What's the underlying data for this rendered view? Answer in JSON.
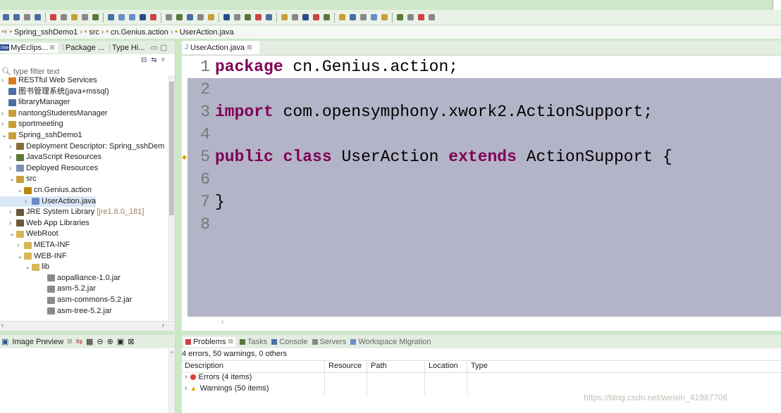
{
  "breadcrumb": [
    "Spring_sshDemo1",
    "src",
    "cn.Genius.action",
    "UserAction.java"
  ],
  "explorer": {
    "tabs": [
      {
        "label": "MyEclips...",
        "close": "⊠"
      },
      {
        "label": "Package ...",
        "close": ""
      },
      {
        "label": "Type Hi...",
        "close": ""
      }
    ],
    "filter_placeholder": "type filter text",
    "items": [
      {
        "label": "RESTful Web Services",
        "indent": 0,
        "twisty": "›",
        "icon": "#d97b1a"
      },
      {
        "label": "图书管理系统(java+mssql)",
        "indent": 0,
        "twisty": "",
        "icon": "#4a6fa5"
      },
      {
        "label": "libraryManager",
        "indent": 0,
        "twisty": "",
        "icon": "#4a6fa5"
      },
      {
        "label": "nantongStudentsManager",
        "indent": 0,
        "twisty": "›",
        "icon": "#c8a038"
      },
      {
        "label": "sportmeeting",
        "indent": 0,
        "twisty": "›",
        "icon": "#c8a038"
      },
      {
        "label": "Spring_sshDemo1",
        "indent": 0,
        "twisty": "⌄",
        "icon": "#c8a038"
      },
      {
        "label": "Deployment Descriptor: Spring_sshDem",
        "indent": 1,
        "twisty": "›",
        "icon": "#8a6d3b"
      },
      {
        "label": "JavaScript Resources",
        "indent": 1,
        "twisty": "›",
        "icon": "#5a7a3a"
      },
      {
        "label": "Deployed Resources",
        "indent": 1,
        "twisty": "›",
        "icon": "#7d8fb3"
      },
      {
        "label": "src",
        "indent": 1,
        "twisty": "⌄",
        "icon": "#c8a038"
      },
      {
        "label": "cn.Genius.action",
        "indent": 2,
        "twisty": "⌄",
        "icon": "#b8860b"
      },
      {
        "label": "UserAction.java",
        "indent": 3,
        "twisty": "›",
        "icon": "#6b8cc7",
        "selected": true
      },
      {
        "label": "JRE System Library",
        "indent": 1,
        "twisty": "›",
        "icon": "#6a5a3a",
        "extra": "[jre1.8.0_181]"
      },
      {
        "label": "Web App Libraries",
        "indent": 1,
        "twisty": "›",
        "icon": "#6a5a3a"
      },
      {
        "label": "WebRoot",
        "indent": 1,
        "twisty": "⌄",
        "icon": "#d6b656"
      },
      {
        "label": "META-INF",
        "indent": 2,
        "twisty": "›",
        "icon": "#d6b656"
      },
      {
        "label": "WEB-INF",
        "indent": 2,
        "twisty": "⌄",
        "icon": "#d6b656"
      },
      {
        "label": "lib",
        "indent": 3,
        "twisty": "⌄",
        "icon": "#d6b656"
      },
      {
        "label": "aopalliance-1.0.jar",
        "indent": 5,
        "twisty": "",
        "icon": "#8a8a8a"
      },
      {
        "label": "asm-5.2.jar",
        "indent": 5,
        "twisty": "",
        "icon": "#8a8a8a"
      },
      {
        "label": "asm-commons-5.2.jar",
        "indent": 5,
        "twisty": "",
        "icon": "#8a8a8a"
      },
      {
        "label": "asm-tree-5.2.jar",
        "indent": 5,
        "twisty": "",
        "icon": "#8a8a8a"
      }
    ]
  },
  "editor": {
    "tab_label": "UserAction.java",
    "lines": [
      {
        "n": "1",
        "parts": [
          {
            "t": "package",
            "k": "kw"
          },
          {
            "t": " cn.Genius.action;",
            "k": "cls"
          }
        ]
      },
      {
        "n": "2",
        "parts": []
      },
      {
        "n": "3",
        "parts": [
          {
            "t": "import",
            "k": "kw"
          },
          {
            "t": " com.opensymphony.xwork2.ActionSupport;",
            "k": "cls"
          }
        ]
      },
      {
        "n": "4",
        "parts": []
      },
      {
        "n": "5",
        "parts": [
          {
            "t": "public",
            "k": "kw"
          },
          {
            "t": " ",
            "k": "cls"
          },
          {
            "t": "class",
            "k": "kw"
          },
          {
            "t": " UserAction ",
            "k": "cls"
          },
          {
            "t": "extends",
            "k": "kw"
          },
          {
            "t": " ActionSupport {",
            "k": "cls"
          }
        ]
      },
      {
        "n": "6",
        "parts": []
      },
      {
        "n": "7",
        "parts": [
          {
            "t": "}",
            "k": "cls"
          }
        ]
      },
      {
        "n": "8",
        "parts": []
      }
    ]
  },
  "image_preview": {
    "tab_label": "Image Preview"
  },
  "problems": {
    "tabs": [
      "Problems",
      "Tasks",
      "Console",
      "Servers",
      "Workspace Migration"
    ],
    "summary": "4 errors, 50 warnings, 0 others",
    "columns": [
      "Description",
      "Resource",
      "Path",
      "Location",
      "Type"
    ],
    "rows": [
      {
        "label": "Errors (4 items)",
        "kind": "error"
      },
      {
        "label": "Warnings (50 items)",
        "kind": "warning"
      }
    ]
  },
  "watermark": "https://blog.csdn.net/weixin_41987706",
  "colors": {
    "keyword": "#7f0055",
    "editor_bg": "#b4b4c8",
    "frame": "#cde8c8"
  }
}
